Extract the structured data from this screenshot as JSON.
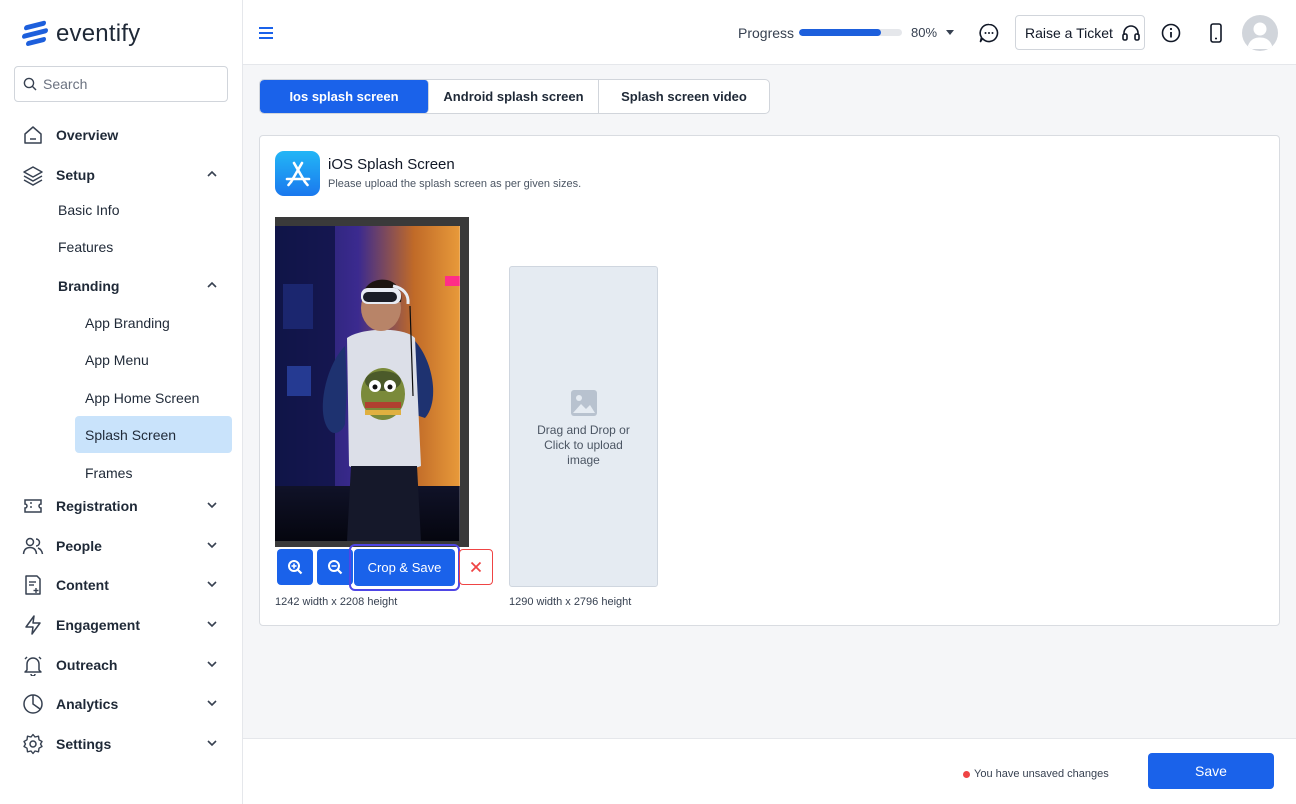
{
  "app": {
    "name": "eventify"
  },
  "search": {
    "placeholder": "Search"
  },
  "sidebar": {
    "items": [
      {
        "label": "Overview"
      },
      {
        "label": "Setup"
      },
      {
        "label": "Registration"
      },
      {
        "label": "People"
      },
      {
        "label": "Content"
      },
      {
        "label": "Engagement"
      },
      {
        "label": "Outreach"
      },
      {
        "label": "Analytics"
      },
      {
        "label": "Settings"
      }
    ],
    "setup_children": [
      {
        "label": "Basic Info"
      },
      {
        "label": "Features"
      },
      {
        "label": "Branding"
      }
    ],
    "branding_children": [
      {
        "label": "App Branding"
      },
      {
        "label": "App Menu"
      },
      {
        "label": "App Home Screen"
      },
      {
        "label": "Splash Screen",
        "active": true
      },
      {
        "label": "Frames"
      }
    ]
  },
  "topbar": {
    "progress_label": "Progress",
    "progress_value": 80,
    "progress_text": "80%",
    "ticket_label": "Raise a Ticket"
  },
  "tabs": [
    {
      "label": "Ios splash screen",
      "active": true
    },
    {
      "label": "Android splash screen"
    },
    {
      "label": "Splash screen video"
    }
  ],
  "section": {
    "title": "iOS Splash Screen",
    "subtitle": "Please upload the splash screen as per given sizes."
  },
  "editor": {
    "crop_label": "Crop & Save",
    "dims": "1242 width x 2208 height"
  },
  "upload": {
    "text": "Drag and Drop or Click to upload image",
    "dims": "1290 width x 2796 height"
  },
  "footer": {
    "unsaved": "You have unsaved changes",
    "save_label": "Save"
  },
  "colors": {
    "primary": "#1a62ea",
    "active_nav": "#c9e3fb",
    "danger": "#ef4444",
    "focus_ring": "#4f46e5"
  },
  "icons": {
    "logo": "eventify-logo-icon",
    "search": "search-icon",
    "menu": "hamburger-icon",
    "chat": "chat-icon",
    "headset": "headset-icon",
    "info": "info-icon",
    "phone": "phone-icon",
    "zoom_in": "zoom-in-icon",
    "zoom_out": "zoom-out-icon",
    "close": "close-icon",
    "image": "image-icon",
    "app_store": "app-store-icon"
  }
}
